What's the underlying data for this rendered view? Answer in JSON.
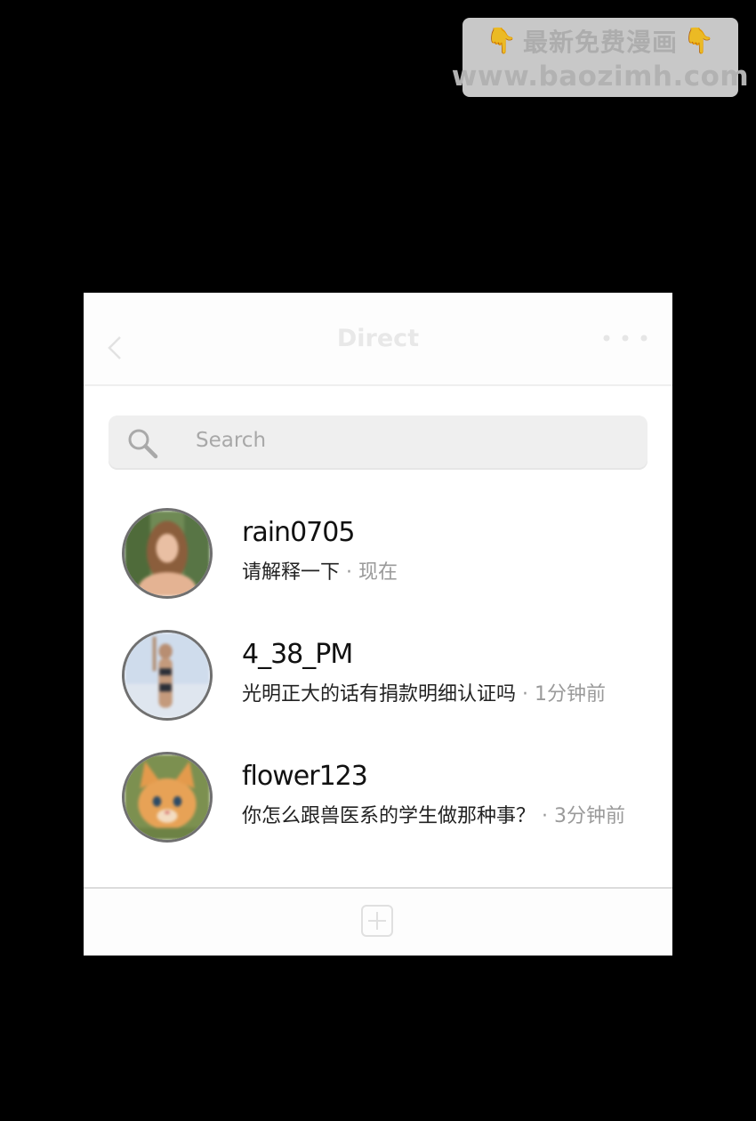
{
  "watermark": {
    "line1": "最新免费漫画",
    "line2": "www.baozimh.com",
    "hand_icon": "pointing-down-hand-icon"
  },
  "header": {
    "title": "Direct",
    "back_icon": "chevron-left-icon",
    "more_icon": "more-dots-icon"
  },
  "search": {
    "placeholder": "Search",
    "icon": "search-icon"
  },
  "conversations": [
    {
      "username": "rain0705",
      "message": "请解释一下",
      "time": "· 现在"
    },
    {
      "username": "4_38_PM",
      "message": "光明正大的话有捐款明细认证吗",
      "time": "· 1分钟前"
    },
    {
      "username": "flower123",
      "message": "你怎么跟兽医系的学生做那种事？",
      "time": "· 3分钟前"
    }
  ],
  "footer": {
    "new_message_icon": "plus-square-icon"
  },
  "colors": {
    "background": "#000000",
    "panel": "#ffffff",
    "search_bg": "#efefef",
    "time_text": "#9a9a9a"
  }
}
